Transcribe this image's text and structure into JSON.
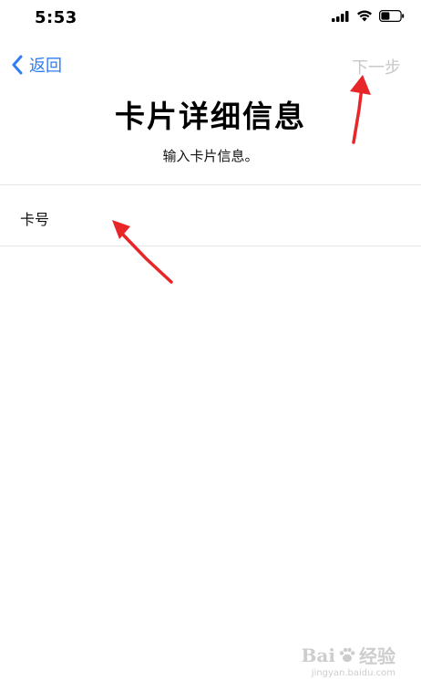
{
  "status_bar": {
    "time": "5:53"
  },
  "nav": {
    "back_label": "返回",
    "next_label": "下一步"
  },
  "header": {
    "title": "卡片详细信息",
    "subtitle": "输入卡片信息。"
  },
  "form": {
    "card_number_label": "卡号",
    "card_number_value": ""
  },
  "watermark": {
    "brand_a": "Bai",
    "brand_b": "经验",
    "url": "jingyan.baidu.com"
  },
  "colors": {
    "accent": "#2f7df6",
    "disabled": "#c7c7cc",
    "annotation": "#e8262a"
  },
  "icons": [
    "signal-icon",
    "wifi-icon",
    "battery-icon",
    "chevron-left-icon",
    "arrow-annotation",
    "paw-icon"
  ]
}
